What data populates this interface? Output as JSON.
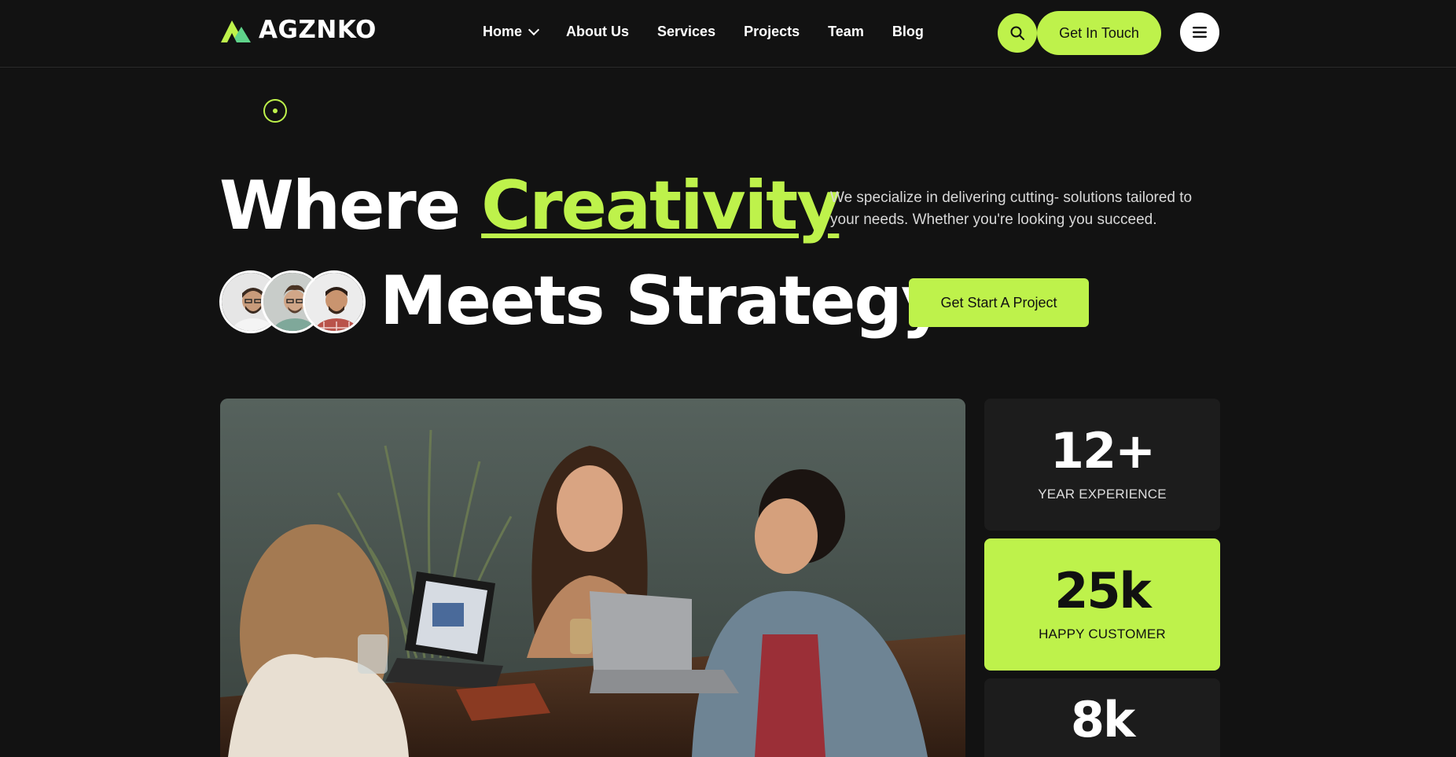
{
  "brand": {
    "name": "AGZNKO",
    "accent": "#bef24b"
  },
  "nav": {
    "items": [
      {
        "label": "Home",
        "has_dropdown": true
      },
      {
        "label": "About Us"
      },
      {
        "label": "Services"
      },
      {
        "label": "Projects"
      },
      {
        "label": "Team"
      },
      {
        "label": "Blog"
      }
    ]
  },
  "header": {
    "search_icon": "search-icon",
    "cta_label": "Get In Touch",
    "menu_icon": "hamburger-icon"
  },
  "hero": {
    "line1_start": "Where ",
    "line1_accent": "Creativity",
    "line2": "Meets Strategy",
    "lede": "We specialize in delivering cutting- solutions tailored to your needs. Whether you're looking you succeed.",
    "cta_label": "Get Start A Project"
  },
  "stats": [
    {
      "value": "12+",
      "label": "YEAR EXPERIENCE"
    },
    {
      "value": "25k",
      "label": "HAPPY CUSTOMER"
    },
    {
      "value": "8k",
      "label": ""
    }
  ]
}
